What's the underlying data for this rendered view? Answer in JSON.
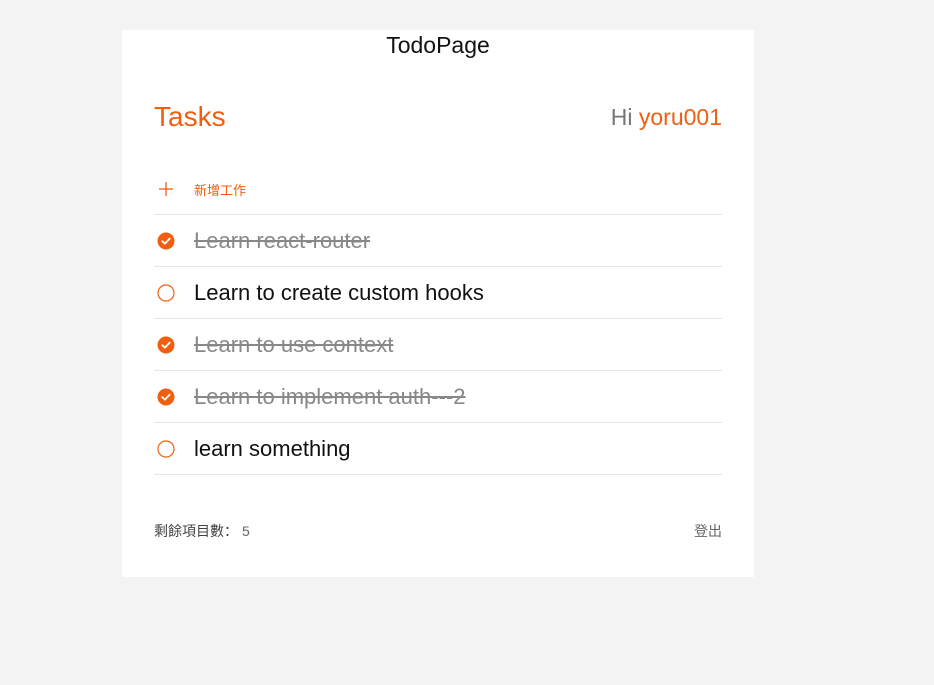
{
  "app": {
    "title": "TodoPage"
  },
  "header": {
    "heading": "Tasks",
    "greeting_prefix": "Hi",
    "username": "yoru001"
  },
  "add_task": {
    "label": "新增工作",
    "icon": "plus-icon"
  },
  "tasks": [
    {
      "text": "Learn react-router",
      "done": true
    },
    {
      "text": "Learn to create custom hooks",
      "done": false
    },
    {
      "text": "Learn to use context",
      "done": true
    },
    {
      "text": "Learn to implement auth---2",
      "done": true
    },
    {
      "text": "learn something",
      "done": false
    }
  ],
  "footer": {
    "remaining_label": "剩餘項目數：",
    "remaining_count": "5",
    "logout_label": "登出"
  },
  "colors": {
    "accent": "#f05f10",
    "background": "#f3f3f3",
    "card": "#ffffff",
    "done_text": "#888888"
  }
}
